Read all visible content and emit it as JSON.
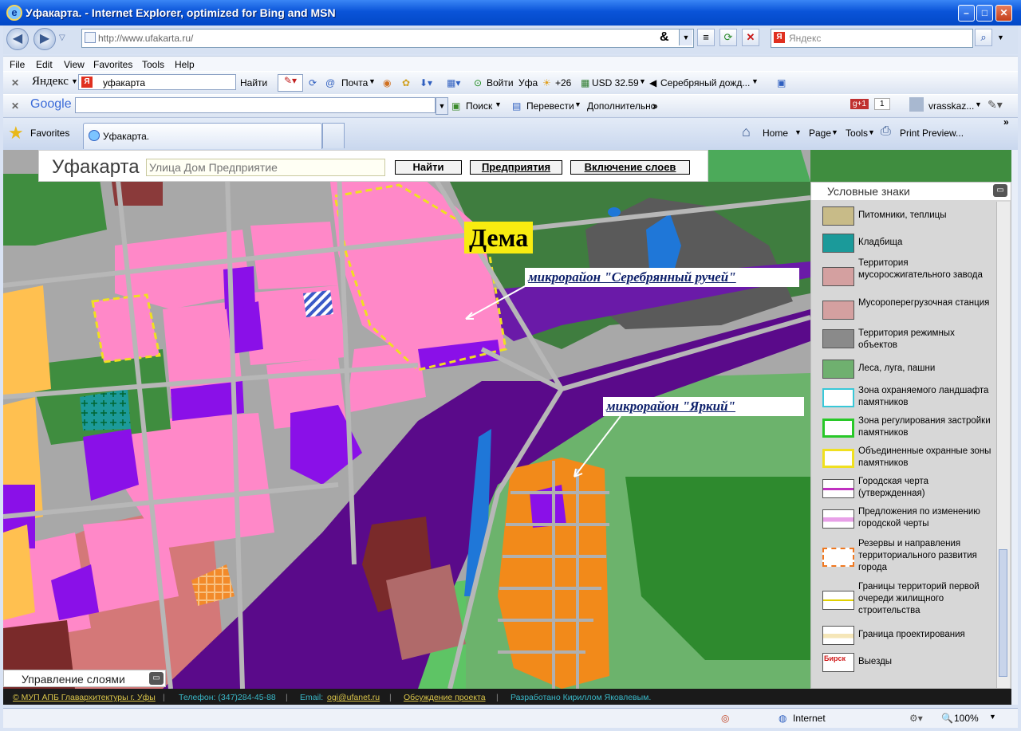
{
  "window": {
    "title": "Уфакарта. - Internet Explorer, optimized for Bing and MSN"
  },
  "address_bar": {
    "url": "http://www.ufakarta.ru/",
    "search_placeholder": "Яндекс"
  },
  "menu": [
    "File",
    "Edit",
    "View",
    "Favorites",
    "Tools",
    "Help"
  ],
  "yandex_bar": {
    "brand": "Яндекс",
    "query": "уфакарта",
    "find_label": "Найти",
    "mail_label": "Почта",
    "login_label": "Войти",
    "city": "Уфа",
    "weather": "+26",
    "currency": "USD 32.59",
    "music": "Серебряный дожд..."
  },
  "google_bar": {
    "brand": "Google",
    "search_label": "Поиск",
    "translate_label": "Перевести",
    "more_label": "Дополнительно",
    "plus_count": "1",
    "user": "vrasskaz..."
  },
  "favorites_bar": {
    "favorites_label": "Favorites",
    "tab_title": "Уфакарта.",
    "home_label": "Home",
    "page_label": "Page",
    "tools_label": "Tools",
    "print_label": "Print Preview..."
  },
  "site": {
    "logo": "Уфакарта",
    "search_placeholder": "Улица Дом Предприятие",
    "find_button": "Найти",
    "enterprises_button": "Предприятия",
    "layers_button": "Включение слоев"
  },
  "map_labels": {
    "dema": "Дема",
    "mkr1": "микрорайон \"Серебрянный ручей\"",
    "mkr2": "микрорайон \"Яркий\""
  },
  "legend": {
    "title": "Условные знаки",
    "items": [
      {
        "label": "Питомники, теплицы",
        "color": "#c8bb88"
      },
      {
        "label": "Кладбища",
        "color": "#1b9a9a"
      },
      {
        "label": "Территория мусоросжигательного завода",
        "color": "#d4a0a0"
      },
      {
        "label": "Мусороперегрузочная станция",
        "color": "#d4a0a0"
      },
      {
        "label": "Территория режимных объектов",
        "color": "#8a8a8a"
      },
      {
        "label": "Леса, луга, пашни",
        "color": "#6fb06f"
      },
      {
        "label": "Зона охраняемого ландшафта памятников",
        "color": "#38c8d8"
      },
      {
        "label": "Зона регулирования застройки памятников",
        "color": "#28c828"
      },
      {
        "label": "Объединенные охранные зоны памятников",
        "color": "#f0e020"
      },
      {
        "label": "Городская черта (утвержденная)",
        "color": "#c030c0"
      },
      {
        "label": "Предложения по изменению городской черты",
        "color": "#e8a0e8"
      },
      {
        "label": "Резервы и направления территориального развития города",
        "color": "#f07820"
      },
      {
        "label": "Границы территорий первой очереди жилищного строительства",
        "color": "#e0d000"
      },
      {
        "label": "Граница проектирования",
        "color": "#f5e6b8"
      },
      {
        "label": "Выезды",
        "badge": "Бирск"
      }
    ]
  },
  "layers_control": {
    "label": "Управление слоями"
  },
  "footer": {
    "copyright": "© МУП АПБ Главархитектуры г. Уфы",
    "phone": "Телефон: (347)284-45-88",
    "email_label": "Email:",
    "email": "ogi@ufanet.ru",
    "discussion": "Обсуждение проекта",
    "author": "Разработано Кириллом Яковлевым."
  },
  "status_bar": {
    "zone": "Internet",
    "zoom": "100%"
  }
}
